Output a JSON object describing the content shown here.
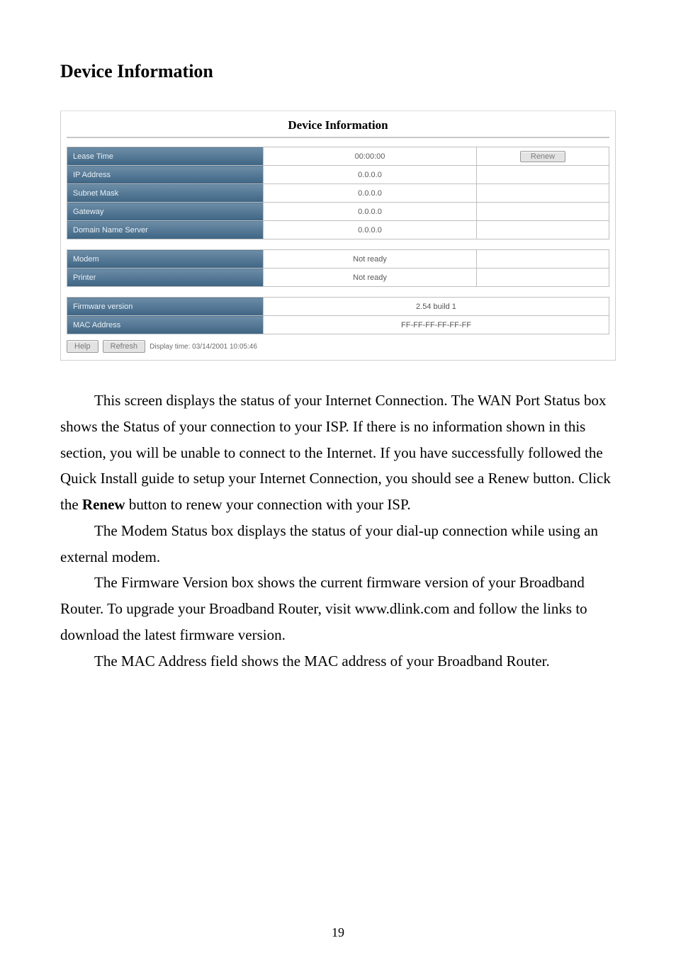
{
  "heading": "Device Information",
  "screenshot": {
    "title": "Device Information",
    "wan_rows": [
      {
        "label": "Lease Time",
        "value": "00:00:00",
        "button": "Renew"
      },
      {
        "label": "IP Address",
        "value": "0.0.0.0",
        "button": null
      },
      {
        "label": "Subnet Mask",
        "value": "0.0.0.0",
        "button": null
      },
      {
        "label": "Gateway",
        "value": "0.0.0.0",
        "button": null
      },
      {
        "label": "Domain Name Server",
        "value": "0.0.0.0",
        "button": null
      }
    ],
    "status_rows": [
      {
        "label": "Modem",
        "value": "Not ready"
      },
      {
        "label": "Printer",
        "value": "Not ready"
      }
    ],
    "fw_rows": [
      {
        "label": "Firmware version",
        "value": "2.54 build 1"
      },
      {
        "label": "MAC Address",
        "value": "FF-FF-FF-FF-FF-FF"
      }
    ],
    "footer": {
      "help": "Help",
      "refresh": "Refresh",
      "display_time": "Display time: 03/14/2001 10:05:46"
    }
  },
  "paragraphs": {
    "p1a": "This screen displays the status of your Internet Connection. The WAN Port Status box shows the Status of your connection to your ISP. If there is no information shown in this section, you will be unable to connect to the Internet. If you have successfully followed the Quick Install guide to setup your Internet Connection, you should see a Renew button. Click the ",
    "p1_strong": "Renew",
    "p1b": " button to renew your connection with your ISP.",
    "p2": "The Modem Status box displays the status of your dial-up connection while using an external modem.",
    "p3": "The Firmware Version box shows the current firmware version of your Broadband Router. To upgrade your Broadband Router, visit www.dlink.com and follow the links to download the latest firmware version.",
    "p4": "The MAC Address field shows the MAC address of your Broadband Router."
  },
  "page_number": "19"
}
